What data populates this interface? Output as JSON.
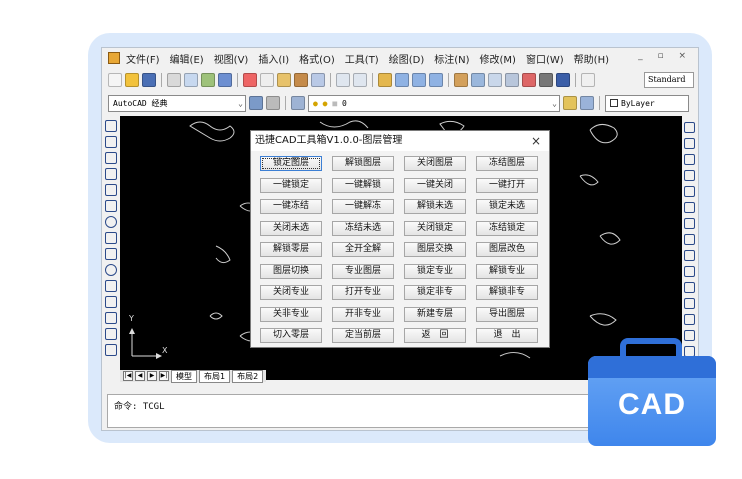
{
  "menu": {
    "items": [
      "文件(F)",
      "编辑(E)",
      "视图(V)",
      "插入(I)",
      "格式(O)",
      "工具(T)",
      "绘图(D)",
      "标注(N)",
      "修改(M)",
      "窗口(W)",
      "帮助(H)"
    ],
    "window_controls": "_ ▫ ×"
  },
  "toolbar": {
    "text_style": "Standard",
    "workspace": "AutoCAD 经典",
    "layer_value": "0",
    "linetype": "ByLayer"
  },
  "canvas": {
    "ucs_x": "X",
    "ucs_y": "Y"
  },
  "tabs": {
    "nav": [
      "|◀",
      "◀",
      "▶",
      "▶|"
    ],
    "items": [
      "模型",
      "布局1",
      "布局2"
    ]
  },
  "command": {
    "text": "命令: TCGL"
  },
  "dialog": {
    "title": "迅捷CAD工具箱V1.0.0-图层管理",
    "close": "×",
    "buttons": [
      "锁定图层",
      "解锁图层",
      "关闭图层",
      "冻结图层",
      "一键锁定",
      "一键解锁",
      "一键关闭",
      "一键打开",
      "一键冻结",
      "一键解冻",
      "解锁未选",
      "锁定未选",
      "关闭未选",
      "冻结未选",
      "关闭锁定",
      "冻结锁定",
      "解锁零层",
      "全开全解",
      "图层交换",
      "图层改色",
      "图层切换",
      "专业图层",
      "锁定专业",
      "解锁专业",
      "关闭专业",
      "打开专业",
      "锁定非专",
      "解锁非专",
      "关非专业",
      "开非专业",
      "新建专层",
      "导出图层",
      "切入零层",
      "定当前层",
      "返　回",
      "退　出"
    ]
  },
  "badge": {
    "text": "CAD"
  },
  "colors": {
    "accent": "#3f86ec",
    "canvas": "#000000"
  }
}
